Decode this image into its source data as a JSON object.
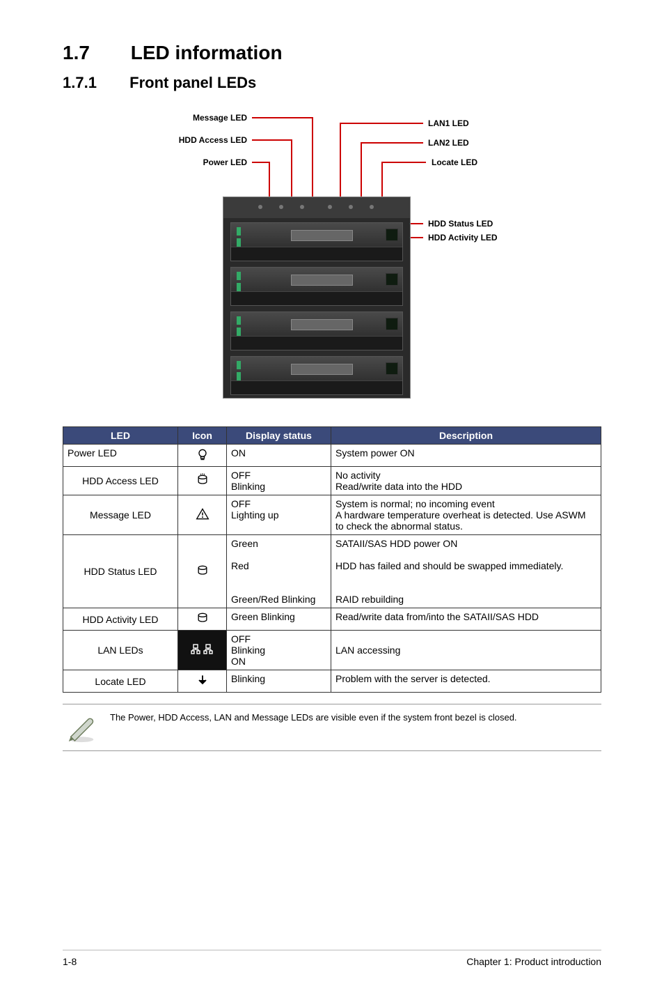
{
  "headings": {
    "section_num": "1.7",
    "section_title": "LED information",
    "subsection_num": "1.7.1",
    "subsection_title": "Front panel LEDs"
  },
  "diagram": {
    "labels": {
      "message_led": "Message LED",
      "hdd_access_led": "HDD Access LED",
      "power_led": "Power LED",
      "lan1_led": "LAN1 LED",
      "lan2_led": "LAN2 LED",
      "locate_led": "Locate LED",
      "hdd_status_led": "HDD Status LED",
      "hdd_activity_led": "HDD Activity LED"
    }
  },
  "table": {
    "headers": {
      "led": "LED",
      "icon": "Icon",
      "display_status": "Display status",
      "description": "Description"
    },
    "rows": [
      {
        "led": "Power LED",
        "icon_name": "power-bulb-icon",
        "status": "ON",
        "desc": "System power ON"
      },
      {
        "led": "HDD Access LED",
        "icon_name": "hdd-cylinder-icon",
        "status": "OFF\nBlinking",
        "desc": "No activity\nRead/write data into the HDD"
      },
      {
        "led": "Message LED",
        "icon_name": "warning-triangle-icon",
        "status": "OFF\nLighting up",
        "desc": "System is normal; no incoming event\nA hardware temperature overheat is detected. Use ASWM to check the abnormal status."
      },
      {
        "led": "HDD Status LED",
        "icon_name": "hdd-cylinder-icon",
        "status": "Green\n\nRed\n\n\nGreen/Red Blinking",
        "desc": "SATAII/SAS HDD power ON\n\nHDD has failed and should be swapped immediately.\n\n\nRAID rebuilding"
      },
      {
        "led": "HDD Activity LED",
        "icon_name": "hdd-cylinder-icon",
        "status": "Green Blinking",
        "desc": "Read/write data from/into the SATAII/SAS HDD"
      },
      {
        "led": "LAN LEDs",
        "icon_name": "lan-pair-icon",
        "status": "OFF\nBlinking\nON",
        "desc": "LAN accessing"
      },
      {
        "led": "Locate LED",
        "icon_name": "locate-arrow-icon",
        "status": "Blinking",
        "desc": "Problem with the server is detected."
      }
    ]
  },
  "note": "The Power, HDD Access, LAN and Message LEDs are visible even if the system front bezel is closed.",
  "footer": {
    "page": "1-8",
    "chapter": "Chapter 1:  Product introduction"
  }
}
